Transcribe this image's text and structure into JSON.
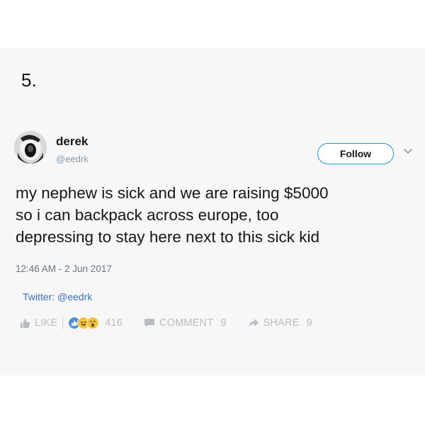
{
  "list_number": "5.",
  "tweet": {
    "display_name": "derek",
    "handle": "@eedrk",
    "follow_label": "Follow",
    "text_lines": [
      "my nephew is sick and we are raising $5000",
      "so i can backpack across europe, too",
      "depressing to stay here next to this sick kid"
    ],
    "timestamp": "12:46 AM - 2 Jun 2017"
  },
  "source_credit": "Twitter: @eedrk",
  "actions": {
    "like_label": "LIKE",
    "reaction_count": "416",
    "comment_label": "COMMENT",
    "comment_count": "9",
    "share_label": "SHARE",
    "share_count": "9"
  },
  "colors": {
    "follow_border": "#1b95e0",
    "source_link": "#3b72b6",
    "action_gray": "#b8bcc2",
    "panel_bg": "#f7f7f7"
  },
  "icons": [
    "thumbs-up-icon",
    "like-reaction-icon",
    "laugh-reaction-icon",
    "wow-reaction-icon",
    "comment-icon",
    "share-arrow-icon",
    "chevron-down-icon"
  ]
}
